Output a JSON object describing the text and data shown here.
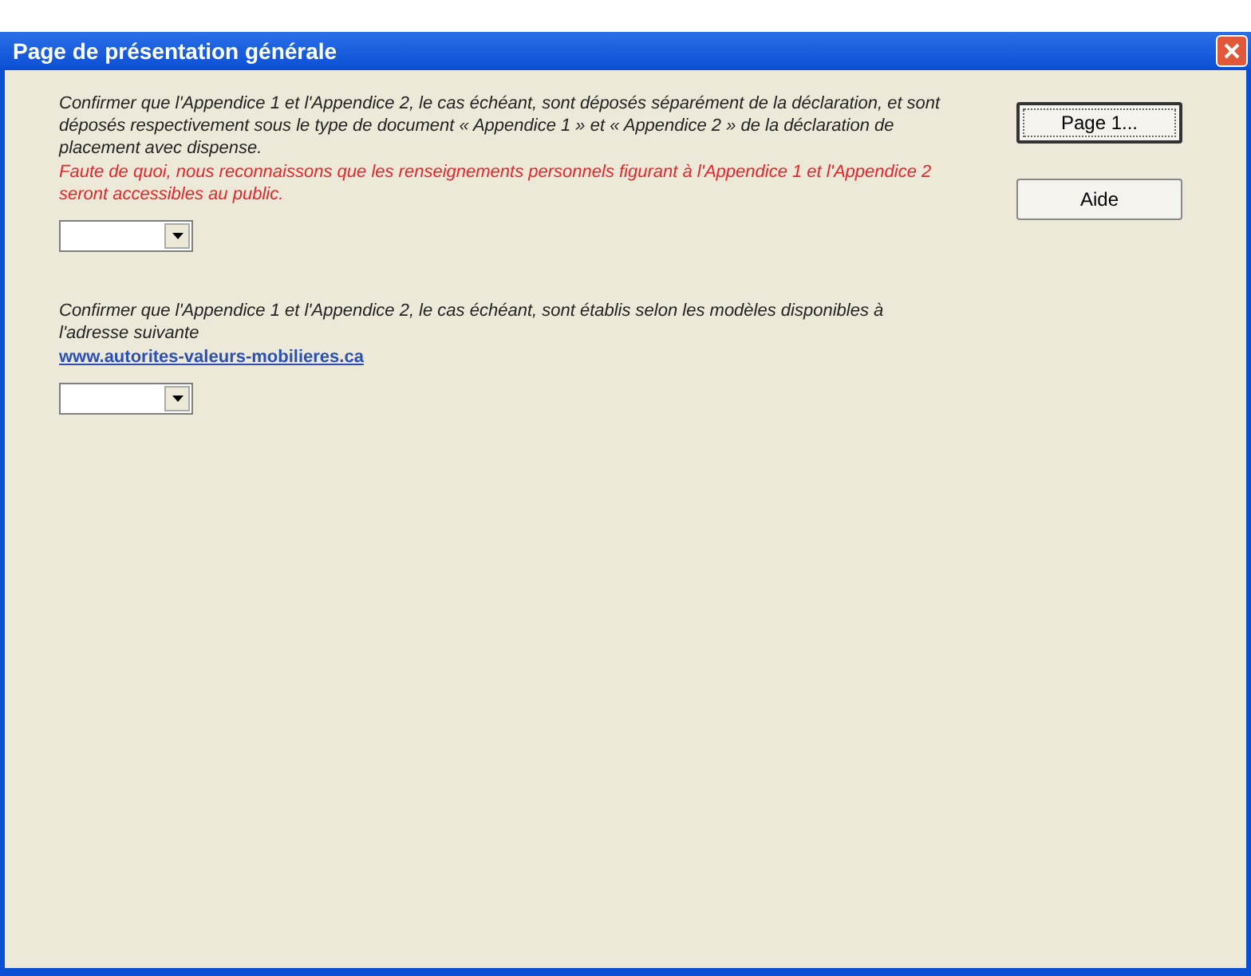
{
  "window": {
    "title": "Page de présentation générale"
  },
  "sections": [
    {
      "paragraphs": [
        {
          "kind": "normal",
          "text": "Confirmer que l'Appendice 1 et l'Appendice 2, le cas échéant, sont déposés séparément de la déclaration, et sont déposés respectivement sous le type de document « Appendice 1 » et « Appendice 2 » de la déclaration de placement avec dispense."
        },
        {
          "kind": "warning",
          "text": "Faute de quoi, nous reconnaissons que les renseignements personnels figurant à l'Appendice 1 et l'Appendice 2 seront accessibles au public."
        }
      ]
    },
    {
      "paragraphs": [
        {
          "kind": "normal",
          "text": "Confirmer que l'Appendice 1 et l'Appendice 2, le cas échéant, sont établis selon les modèles disponibles à l'adresse suivante"
        },
        {
          "kind": "link",
          "text": "www.autorites-valeurs-mobilieres.ca"
        }
      ]
    }
  ],
  "buttons": [
    {
      "label": "Page 1...",
      "selected": true
    },
    {
      "label": "Aide",
      "selected": false
    }
  ]
}
